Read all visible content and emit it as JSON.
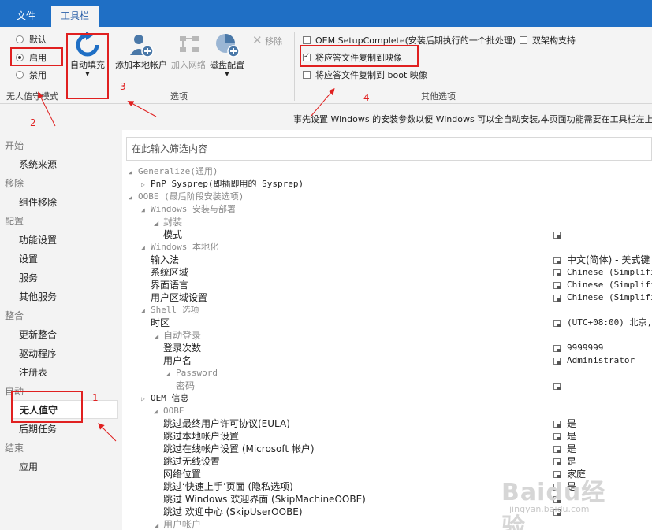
{
  "tabs": [
    {
      "label": "文件"
    },
    {
      "label": "工具栏"
    }
  ],
  "ribbon": {
    "unattended_group": {
      "options": [
        {
          "label": "默认",
          "selected": false
        },
        {
          "label": "启用",
          "selected": true
        },
        {
          "label": "禁用",
          "selected": false
        }
      ],
      "label": "无人值守模式"
    },
    "options_group": {
      "autofill": "自动填充",
      "add_local_account": "添加本地帐户",
      "add_network": "加入网络",
      "disk_config": "磁盘配置",
      "remove": "移除",
      "label": "选项"
    },
    "other_group": {
      "oem_setup_complete": "OEM SetupComplete(安装后期执行的一个批处理)",
      "dual_arch": "双架构支持",
      "copy_answer_to_image": "将应答文件复制到映像",
      "copy_answer_to_boot": "将应答文件复制到 boot 映像",
      "label": "其他选项",
      "oem_checked": false,
      "dual_checked": false,
      "copy_image_checked": true,
      "copy_boot_checked": false
    }
  },
  "description": "事先设置 Windows 的安装参数以便 Windows 可以全自动安装,本页面功能需要在工具栏左上",
  "sidebar": {
    "sections": [
      {
        "head": "开始",
        "items": [
          "系统来源"
        ]
      },
      {
        "head": "移除",
        "items": [
          "组件移除"
        ]
      },
      {
        "head": "配置",
        "items": [
          "功能设置",
          "设置",
          "服务",
          "其他服务"
        ]
      },
      {
        "head": "整合",
        "items": [
          "更新整合",
          "驱动程序",
          "注册表"
        ]
      },
      {
        "head": "自动",
        "items": [
          "无人值守",
          "后期任务"
        ]
      },
      {
        "head": "结束",
        "items": [
          "应用"
        ]
      }
    ]
  },
  "filter_placeholder": "在此输入筛选内容",
  "tree": [
    {
      "label": "Generalize(通用)",
      "type": "cat",
      "tri": "◢"
    },
    {
      "label": "PnP Sysprep(即插即用的 Sysprep)",
      "type": "mono",
      "tri": "▷"
    },
    {
      "label": "OOBE (最后阶段安装选项)",
      "type": "cat",
      "tri": "◢"
    },
    {
      "label": "Windows 安装与部署",
      "type": "cat",
      "tri": "◢"
    },
    {
      "label": "封装",
      "type": "muted",
      "tri": "◢"
    },
    {
      "label": "模式",
      "value": ""
    },
    {
      "label": "Windows 本地化",
      "type": "cat",
      "tri": "◢"
    },
    {
      "label": "输入法",
      "value": "中文(简体) - 美式键"
    },
    {
      "label": "系统区域",
      "value": "Chinese (Simplified"
    },
    {
      "label": "界面语言",
      "value": "Chinese (Simplified"
    },
    {
      "label": "用户区域设置",
      "value": "Chinese (Simplified"
    },
    {
      "label": "Shell 选项",
      "type": "cat",
      "tri": "◢"
    },
    {
      "label": "时区",
      "value": "(UTC+08:00) 北京,"
    },
    {
      "label": "自动登录",
      "type": "muted",
      "tri": "◢"
    },
    {
      "label": "登录次数",
      "value": "9999999"
    },
    {
      "label": "用户名",
      "value": "Administrator"
    },
    {
      "label": "Password",
      "type": "cat",
      "tri": "◢"
    },
    {
      "label": "密码",
      "type": "muted",
      "value": ""
    },
    {
      "label": "OEM 信息",
      "type": "mono",
      "tri": "▷"
    },
    {
      "label": "OOBE",
      "type": "cat",
      "tri": "◢"
    },
    {
      "label": "跳过最终用户许可协议(EULA)",
      "value": "是"
    },
    {
      "label": "跳过本地帐户设置",
      "value": "是"
    },
    {
      "label": "跳过在线帐户设置 (Microsoft 帐户)",
      "value": "是"
    },
    {
      "label": "跳过无线设置",
      "value": "是"
    },
    {
      "label": "网络位置",
      "value": "家庭"
    },
    {
      "label": "跳过‘快速上手’页面 (隐私选项)",
      "value": "是"
    },
    {
      "label": "跳过 Windows 欢迎界面 (SkipMachineOOBE)",
      "value": ""
    },
    {
      "label": "跳过 欢迎中心 (SkipUserOOBE)",
      "value": ""
    },
    {
      "label": "用户帐户",
      "type": "muted",
      "tri": "◢"
    }
  ],
  "annotations": [
    "1",
    "2",
    "3",
    "4"
  ],
  "watermark": {
    "brand": "Baidu经验",
    "sub": "jingyan.baidu.com"
  },
  "colors": {
    "accent": "#1f6fc5",
    "annotation": "#e02020"
  }
}
